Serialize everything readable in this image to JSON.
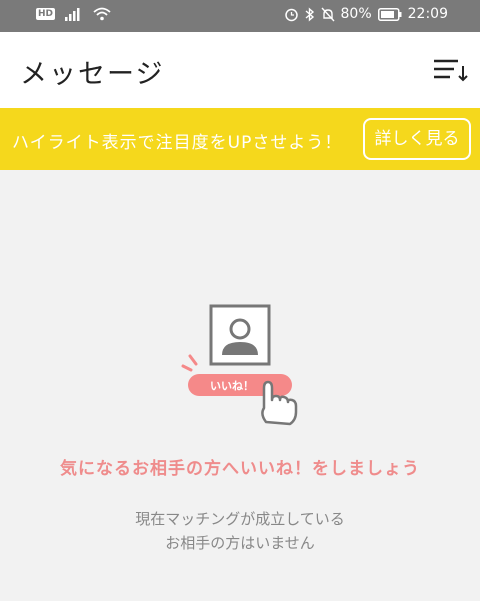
{
  "status_bar": {
    "network": "HD",
    "battery": "80%",
    "time": "22:09"
  },
  "header": {
    "title": "メッセージ"
  },
  "banner": {
    "text": "ハイライト表示で注目度をUPさせよう！",
    "button_label": "詳しく見る"
  },
  "illustration": {
    "like_label": "いいね！"
  },
  "empty_state": {
    "title": "気になるお相手の方へいいね！をしましょう",
    "line1": "現在マッチングが成立している",
    "line2": "お相手の方はいません"
  },
  "colors": {
    "banner": "#f5d81c",
    "accent_pink": "#ef8c8c",
    "status_bar": "#7a7a7a"
  }
}
